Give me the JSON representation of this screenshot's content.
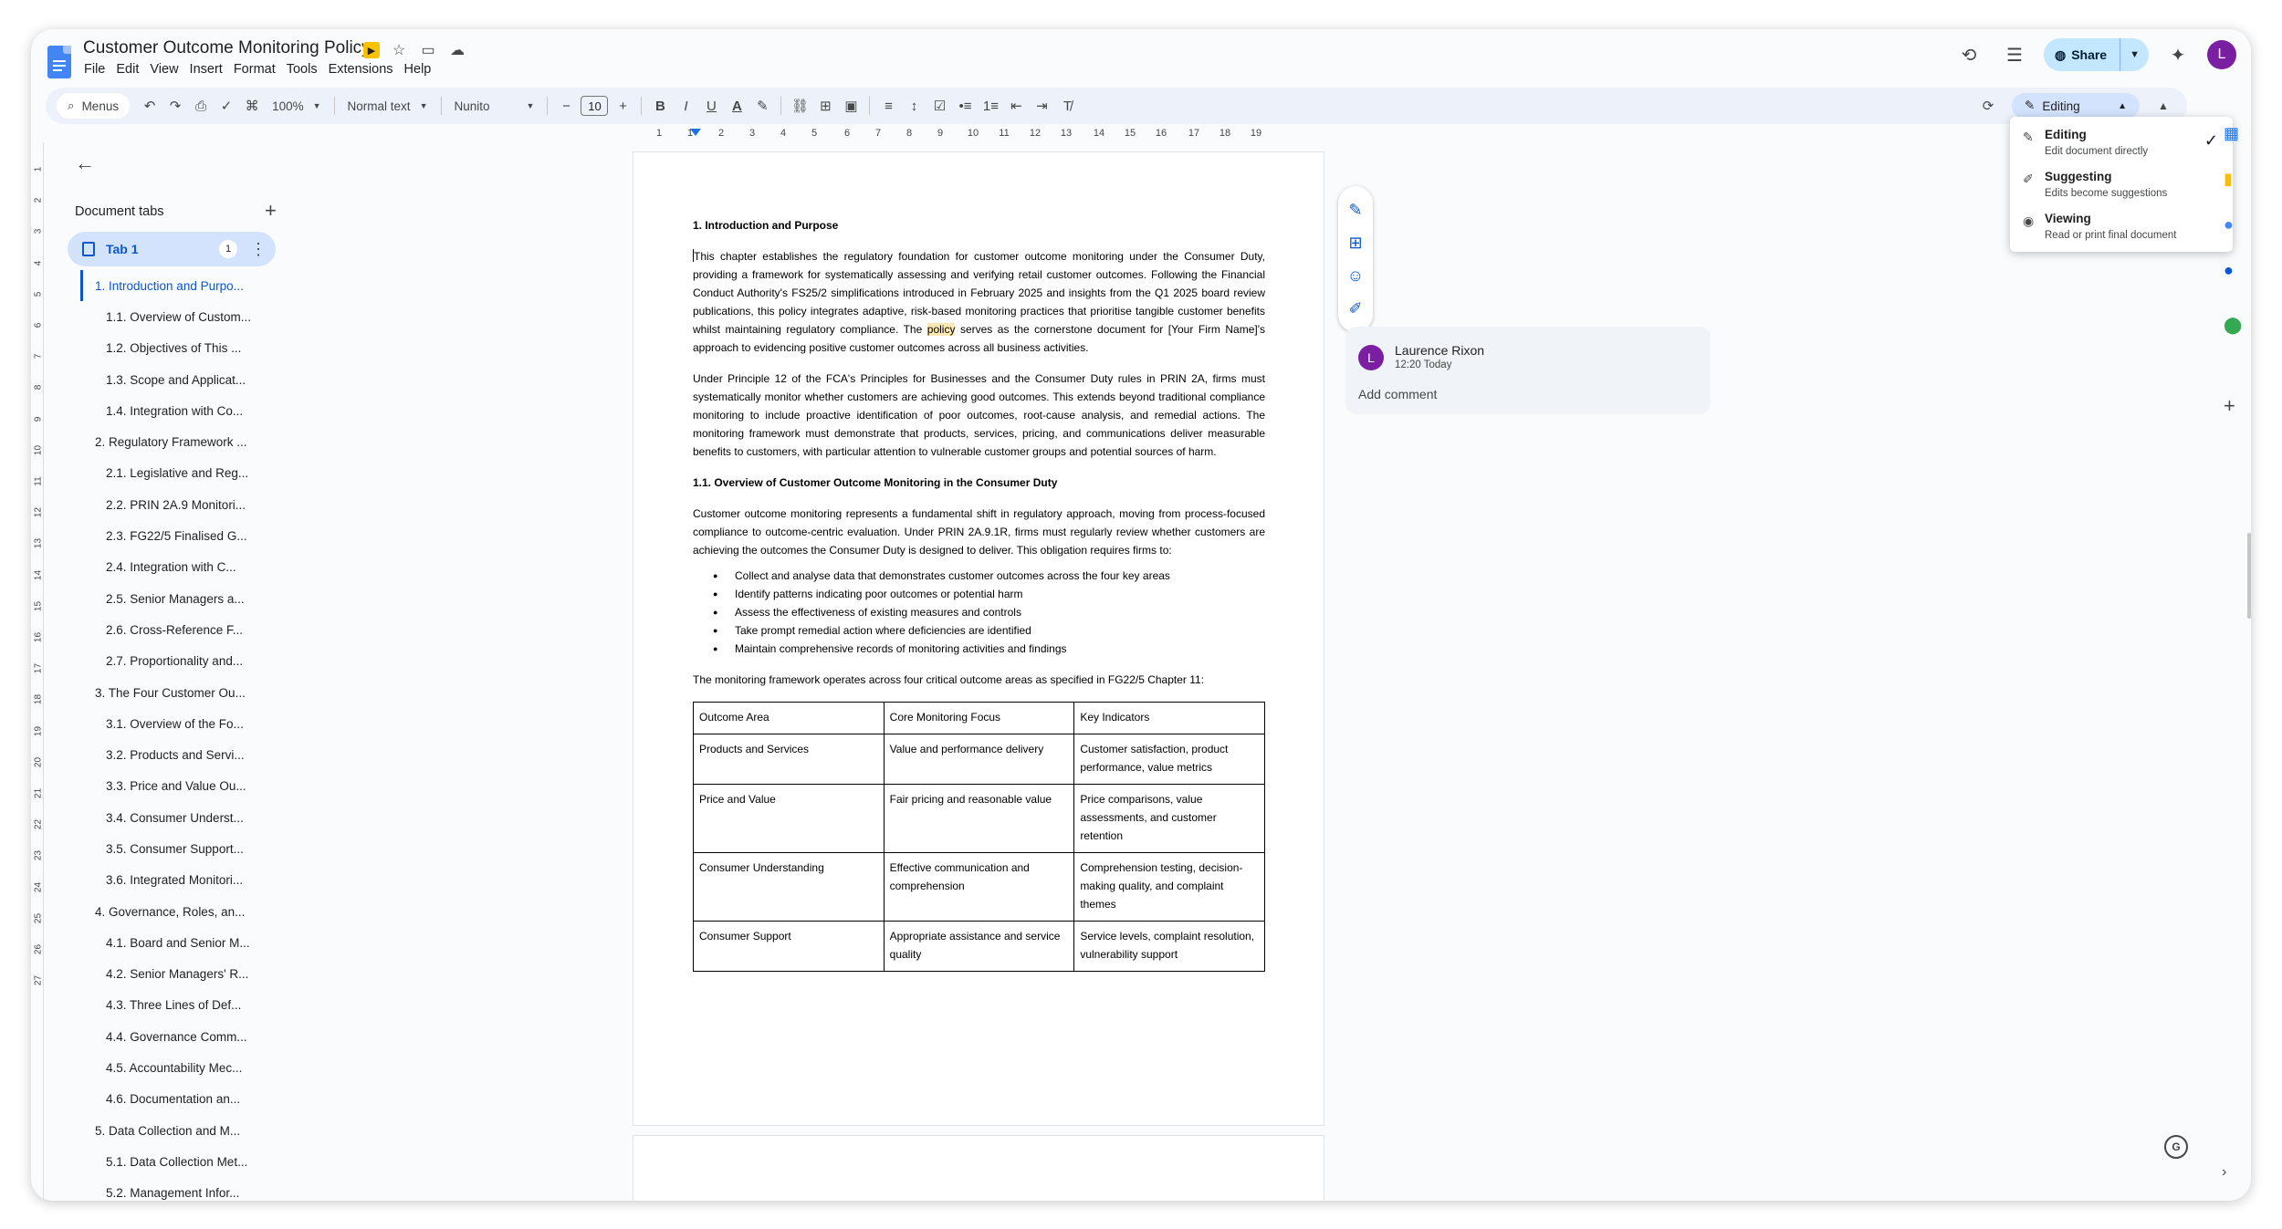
{
  "app": {
    "doc_title": "Customer Outcome Monitoring Policy",
    "menus": [
      "File",
      "Edit",
      "View",
      "Insert",
      "Format",
      "Tools",
      "Extensions",
      "Help"
    ],
    "share_label": "Share",
    "avatar_letter": "L"
  },
  "toolbar": {
    "menus_label": "Menus",
    "zoom": "100%",
    "style": "Normal text",
    "font": "Nunito",
    "font_size": "10",
    "mode_label": "Editing"
  },
  "ruler": [
    "1",
    "1",
    "2",
    "3",
    "4",
    "5",
    "6",
    "7",
    "8",
    "9",
    "10",
    "11",
    "12",
    "13",
    "14",
    "15",
    "16",
    "17",
    "18",
    "19"
  ],
  "ruler_v": [
    "1",
    "2",
    "3",
    "4",
    "5",
    "6",
    "7",
    "8",
    "9",
    "10",
    "11",
    "12",
    "13",
    "14",
    "15",
    "16",
    "17",
    "18",
    "19",
    "20",
    "21",
    "22",
    "23",
    "24",
    "25",
    "26",
    "27"
  ],
  "sidebar": {
    "heading": "Document tabs",
    "tab_name": "Tab 1",
    "tab_badge": "1",
    "outline": [
      {
        "label": "1. Introduction and Purpo...",
        "level": 1,
        "active": true
      },
      {
        "label": "1.1. Overview of Custom...",
        "level": 2
      },
      {
        "label": "1.2. Objectives of This ...",
        "level": 2
      },
      {
        "label": "1.3. Scope and Applicat...",
        "level": 2
      },
      {
        "label": "1.4. Integration with Co...",
        "level": 2
      },
      {
        "label": "2. Regulatory Framework ...",
        "level": 1
      },
      {
        "label": "2.1. Legislative and Reg...",
        "level": 2
      },
      {
        "label": "2.2. PRIN 2A.9 Monitori...",
        "level": 2
      },
      {
        "label": "2.3. FG22/5 Finalised G...",
        "level": 2
      },
      {
        "label": "2.4. Integration with C...",
        "level": 2
      },
      {
        "label": "2.5. Senior Managers a...",
        "level": 2
      },
      {
        "label": "2.6. Cross-Reference F...",
        "level": 2
      },
      {
        "label": "2.7. Proportionality and...",
        "level": 2
      },
      {
        "label": "3. The Four Customer Ou...",
        "level": 1
      },
      {
        "label": "3.1. Overview of the Fo...",
        "level": 2
      },
      {
        "label": "3.2. Products and Servi...",
        "level": 2
      },
      {
        "label": "3.3. Price and Value Ou...",
        "level": 2
      },
      {
        "label": "3.4. Consumer Underst...",
        "level": 2
      },
      {
        "label": "3.5. Consumer Support...",
        "level": 2
      },
      {
        "label": "3.6. Integrated Monitori...",
        "level": 2
      },
      {
        "label": "4. Governance, Roles, an...",
        "level": 1
      },
      {
        "label": "4.1. Board and Senior M...",
        "level": 2
      },
      {
        "label": "4.2. Senior Managers' R...",
        "level": 2
      },
      {
        "label": "4.3. Three Lines of Def...",
        "level": 2
      },
      {
        "label": "4.4. Governance Comm...",
        "level": 2
      },
      {
        "label": "4.5. Accountability Mec...",
        "level": 2
      },
      {
        "label": "4.6. Documentation an...",
        "level": 2
      },
      {
        "label": "5. Data Collection and M...",
        "level": 1
      },
      {
        "label": "5.1. Data Collection Met...",
        "level": 2
      },
      {
        "label": "5.2. Management Infor...",
        "level": 2
      }
    ]
  },
  "document": {
    "h1": "1. Introduction and Purpose",
    "p1_a": "This chapter establishes the regulatory foundation for customer outcome monitoring under the Consumer Duty, providing a framework for systematically assessing and verifying retail customer outcomes. Following the Financial Conduct Authority's FS25/2 simplifications introduced in February 2025 and insights from the Q1 2025 board review publications, this policy integrates adaptive, risk-based monitoring practices that prioritise tangible customer benefits whilst maintaining regulatory compliance. The ",
    "p1_hl": "policy",
    "p1_b": " serves as the cornerstone document for [Your Firm Name]'s approach to evidencing positive customer outcomes across all business activities.",
    "p2": "Under Principle 12 of the FCA's Principles for Businesses and the Consumer Duty rules in PRIN 2A, firms must systematically monitor whether customers are achieving good outcomes. This extends beyond traditional compliance monitoring to include proactive identification of poor outcomes, root-cause analysis, and remedial actions. The monitoring framework must demonstrate that products, services, pricing, and communications deliver measurable benefits to customers, with particular attention to vulnerable customer groups and potential sources of harm.",
    "h2": "1.1. Overview of Customer Outcome Monitoring in the Consumer Duty",
    "p3": "Customer outcome monitoring represents a fundamental shift in regulatory approach, moving from process-focused compliance to outcome-centric evaluation. Under PRIN 2A.9.1R, firms must regularly review whether customers are achieving the outcomes the Consumer Duty is designed to deliver. This obligation requires firms to:",
    "bullets": [
      "Collect and analyse data that demonstrates customer outcomes across the four key areas",
      "Identify patterns indicating poor outcomes or potential harm",
      "Assess the effectiveness of existing measures and controls",
      "Take prompt remedial action where deficiencies are identified",
      "Maintain comprehensive records of monitoring activities and findings"
    ],
    "p4": "The monitoring framework operates across four critical outcome areas as specified in FG22/5 Chapter 11:",
    "table": [
      [
        "Outcome Area",
        "Core Monitoring Focus",
        "Key Indicators"
      ],
      [
        "Products and Services",
        "Value and performance delivery",
        "Customer satisfaction, product performance, value metrics"
      ],
      [
        "Price and Value",
        "Fair pricing and reasonable value",
        "Price comparisons, value assessments, and customer retention"
      ],
      [
        "Consumer Understanding",
        "Effective communication and comprehension",
        "Comprehension testing, decision-making quality, and complaint themes"
      ],
      [
        "Consumer Support",
        "Appropriate assistance and service quality",
        "Service levels, complaint resolution, vulnerability support"
      ]
    ]
  },
  "comment": {
    "avatar": "L",
    "author": "Laurence Rixon",
    "time": "12:20 Today",
    "add_label": "Add comment"
  },
  "mode_menu": [
    {
      "title": "Editing",
      "subtitle": "Edit document directly",
      "selected": true
    },
    {
      "title": "Suggesting",
      "subtitle": "Edits become suggestions"
    },
    {
      "title": "Viewing",
      "subtitle": "Read or print final document"
    }
  ],
  "colors": {
    "accent": "#0b57d0",
    "toolbar_bg": "#edf2fa",
    "share_bg": "#c2e7ff",
    "avatar": "#7b1fa2",
    "highlight": "#fce8b2"
  }
}
